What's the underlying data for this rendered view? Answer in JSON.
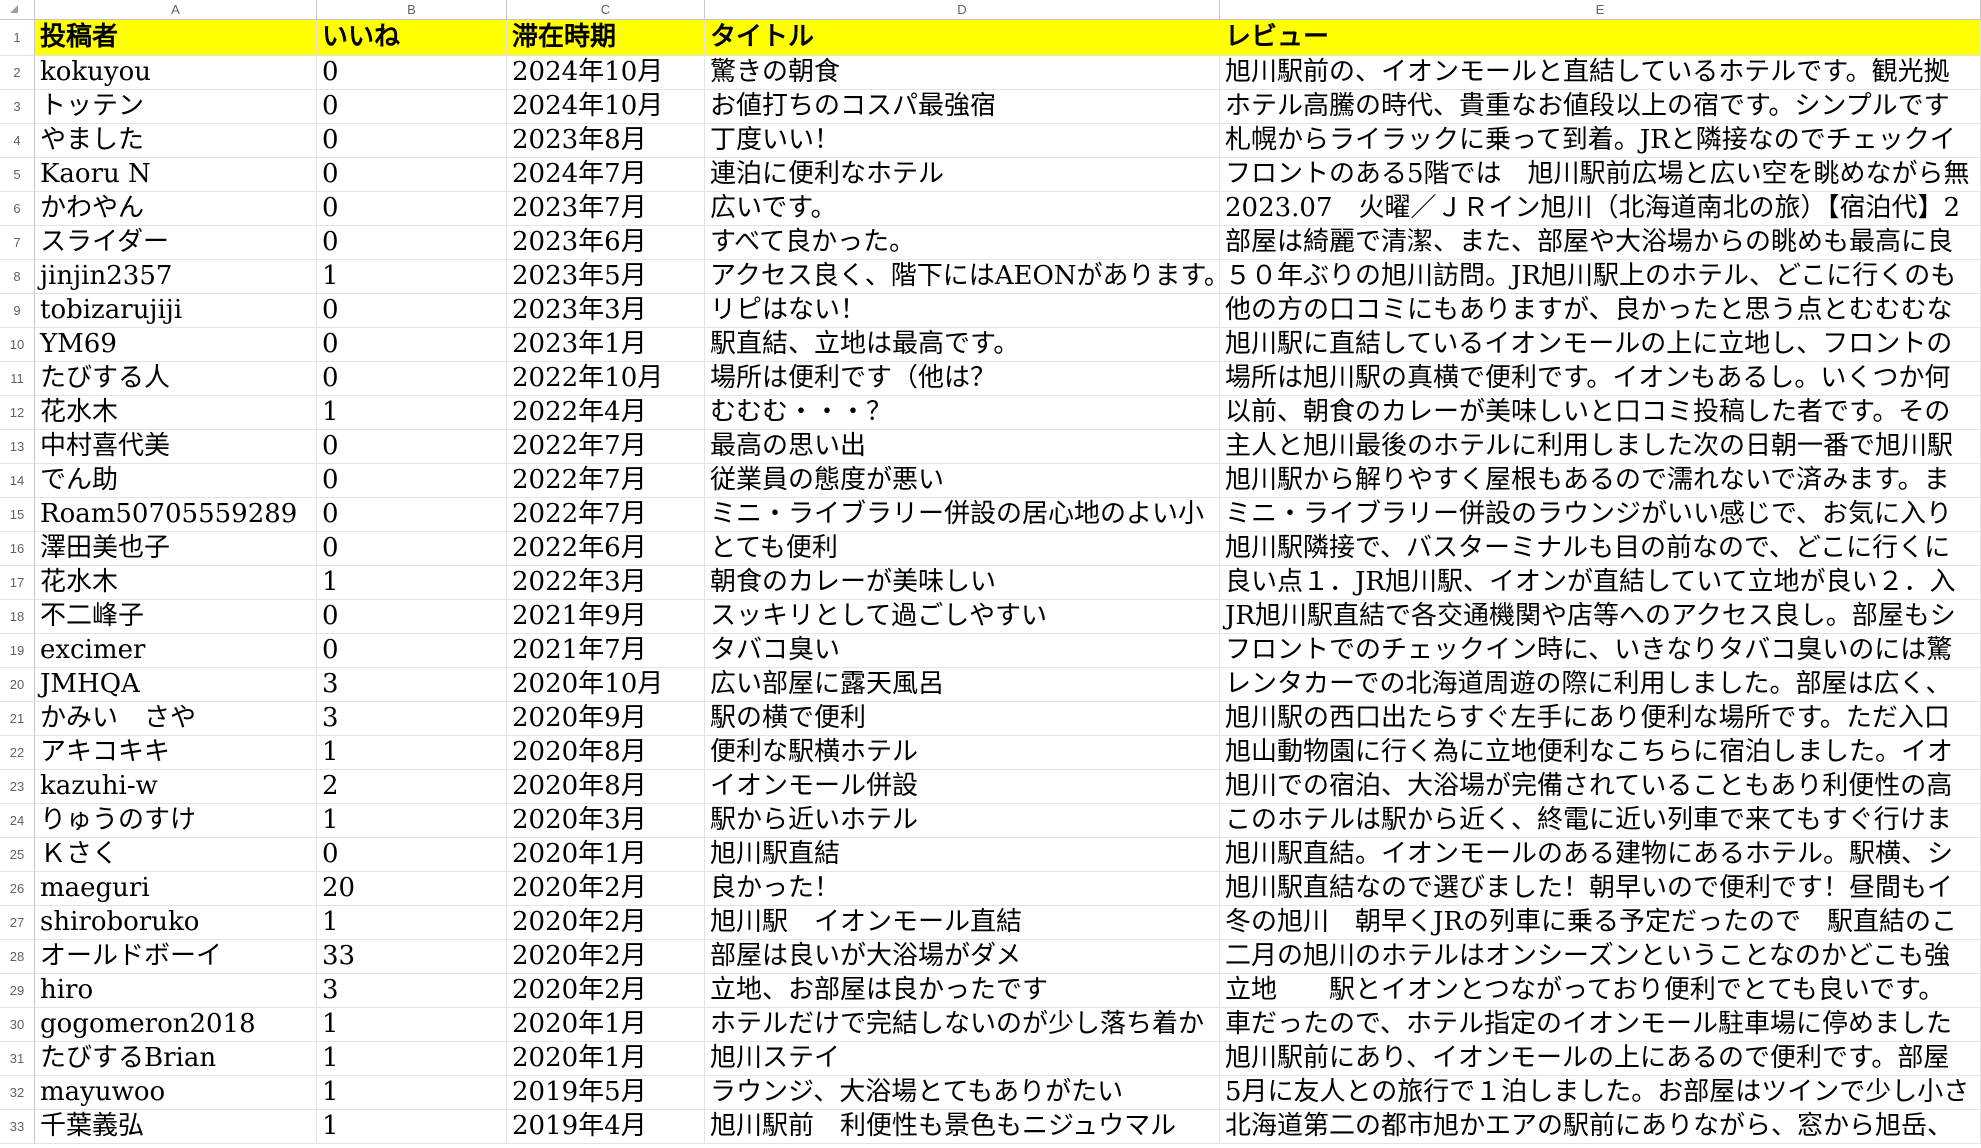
{
  "sheet": {
    "column_letters": [
      "A",
      "B",
      "C",
      "D",
      "E"
    ],
    "header": {
      "row_number": "1",
      "cells": [
        "投稿者",
        "いいね",
        "滞在時期",
        "タイトル",
        "レビュー"
      ]
    },
    "rows": [
      {
        "row_number": "2",
        "cells": [
          "kokuyou",
          "0",
          "2024年10月",
          "驚きの朝食",
          "旭川駅前の、イオンモールと直結しているホテルです。観光拠"
        ]
      },
      {
        "row_number": "3",
        "cells": [
          "トッテン",
          "0",
          "2024年10月",
          "お値打ちのコスパ最強宿",
          "ホテル高騰の時代、貴重なお値段以上の宿です。シンプルです"
        ]
      },
      {
        "row_number": "4",
        "cells": [
          "やました",
          "0",
          "2023年8月",
          "丁度いい！",
          "札幌からライラックに乗って到着。JRと隣接なのでチェックイ"
        ]
      },
      {
        "row_number": "5",
        "cells": [
          "Kaoru N",
          "0",
          "2024年7月",
          "連泊に便利なホテル",
          "フロントのある5階では　旭川駅前広場と広い空を眺めながら無"
        ]
      },
      {
        "row_number": "6",
        "cells": [
          "かわやん",
          "0",
          "2023年7月",
          "広いです。",
          "2023.07　火曜／ＪＲイン旭川（北海道南北の旅）【宿泊代】2"
        ]
      },
      {
        "row_number": "7",
        "cells": [
          "スライダー",
          "0",
          "2023年6月",
          "すべて良かった。",
          "部屋は綺麗で清潔、また、部屋や大浴場からの眺めも最高に良"
        ]
      },
      {
        "row_number": "8",
        "cells": [
          "jinjin2357",
          "1",
          "2023年5月",
          "アクセス良く、階下にはAEONがあります。",
          "５０年ぶりの旭川訪問。JR旭川駅上のホテル、どこに行くのも"
        ]
      },
      {
        "row_number": "9",
        "cells": [
          "tobizarujiji",
          "0",
          "2023年3月",
          "リピはない！",
          "他の方の口コミにもありますが、良かったと思う点とむむむな"
        ]
      },
      {
        "row_number": "10",
        "cells": [
          "YM69",
          "0",
          "2023年1月",
          "駅直結、立地は最高です。",
          "旭川駅に直結しているイオンモールの上に立地し、フロントの"
        ]
      },
      {
        "row_number": "11",
        "cells": [
          "たびする人",
          "0",
          "2022年10月",
          "場所は便利です（他は？",
          "場所は旭川駅の真横で便利です。イオンもあるし。いくつか何"
        ]
      },
      {
        "row_number": "12",
        "cells": [
          "花水木",
          "1",
          "2022年4月",
          "むむむ・・・？",
          "以前、朝食のカレーが美味しいと口コミ投稿した者です。その"
        ]
      },
      {
        "row_number": "13",
        "cells": [
          "中村喜代美",
          "0",
          "2022年7月",
          "最高の思い出",
          "主人と旭川最後のホテルに利用しました次の日朝一番で旭川駅"
        ]
      },
      {
        "row_number": "14",
        "cells": [
          "でん助",
          "0",
          "2022年7月",
          "従業員の態度が悪い",
          "旭川駅から解りやすく屋根もあるので濡れないで済みます。ま"
        ]
      },
      {
        "row_number": "15",
        "cells": [
          "Roam50705559289",
          "0",
          "2022年7月",
          "ミニ・ライブラリー併設の居心地のよい小",
          "ミニ・ライブラリー併設のラウンジがいい感じで、お気に入り"
        ]
      },
      {
        "row_number": "16",
        "cells": [
          "澤田美也子",
          "0",
          "2022年6月",
          "とても便利",
          "旭川駅隣接で、バスターミナルも目の前なので、どこに行くに"
        ]
      },
      {
        "row_number": "17",
        "cells": [
          "花水木",
          "1",
          "2022年3月",
          "朝食のカレーが美味しい",
          "良い点１．JR旭川駅、イオンが直結していて立地が良い２．入"
        ]
      },
      {
        "row_number": "18",
        "cells": [
          "不二峰子",
          "0",
          "2021年9月",
          "スッキリとして過ごしやすい",
          "JR旭川駅直結で各交通機関や店等へのアクセス良し。部屋もシ"
        ]
      },
      {
        "row_number": "19",
        "cells": [
          "excimer",
          "0",
          "2021年7月",
          "タバコ臭い",
          "フロントでのチェックイン時に、いきなりタバコ臭いのには驚"
        ]
      },
      {
        "row_number": "20",
        "cells": [
          "JMHQA",
          "3",
          "2020年10月",
          "広い部屋に露天風呂",
          "レンタカーでの北海道周遊の際に利用しました。部屋は広く、"
        ]
      },
      {
        "row_number": "21",
        "cells": [
          "かみい　さや",
          "3",
          "2020年9月",
          "駅の横で便利",
          "旭川駅の西口出たらすぐ左手にあり便利な場所です。ただ入口"
        ]
      },
      {
        "row_number": "22",
        "cells": [
          "アキコキキ",
          "1",
          "2020年8月",
          "便利な駅横ホテル",
          "旭山動物園に行く為に立地便利なこちらに宿泊しました。イオ"
        ]
      },
      {
        "row_number": "23",
        "cells": [
          "kazuhi-w",
          "2",
          "2020年8月",
          "イオンモール併設",
          "旭川での宿泊、大浴場が完備されていることもあり利便性の高"
        ]
      },
      {
        "row_number": "24",
        "cells": [
          "りゅうのすけ",
          "1",
          "2020年3月",
          "駅から近いホテル",
          "このホテルは駅から近く、終電に近い列車で来てもすぐ行けま"
        ]
      },
      {
        "row_number": "25",
        "cells": [
          "Ｋさく",
          "0",
          "2020年1月",
          "旭川駅直結",
          "旭川駅直結。イオンモールのある建物にあるホテル。駅横、シ"
        ]
      },
      {
        "row_number": "26",
        "cells": [
          "maeguri",
          "20",
          "2020年2月",
          "良かった！",
          "旭川駅直結なので選びました！朝早いので便利です！昼間もイ"
        ]
      },
      {
        "row_number": "27",
        "cells": [
          "shiroboruko",
          "1",
          "2020年2月",
          "旭川駅　イオンモール直結",
          "冬の旭川　朝早くJRの列車に乗る予定だったので　駅直結のこ"
        ]
      },
      {
        "row_number": "28",
        "cells": [
          "オールドボーイ",
          "33",
          "2020年2月",
          "部屋は良いが大浴場がダメ",
          "二月の旭川のホテルはオンシーズンということなのかどこも強"
        ]
      },
      {
        "row_number": "29",
        "cells": [
          "hiro",
          "3",
          "2020年2月",
          "立地、お部屋は良かったです",
          "立地　　駅とイオンとつながっており便利でとても良いです。"
        ]
      },
      {
        "row_number": "30",
        "cells": [
          "gogomeron2018",
          "1",
          "2020年1月",
          "ホテルだけで完結しないのが少し落ち着か",
          "車だったので、ホテル指定のイオンモール駐車場に停めました"
        ]
      },
      {
        "row_number": "31",
        "cells": [
          "たびするBrian",
          "1",
          "2020年1月",
          "旭川ステイ",
          "旭川駅前にあり、イオンモールの上にあるので便利です。部屋"
        ]
      },
      {
        "row_number": "32",
        "cells": [
          "mayuwoo",
          "1",
          "2019年5月",
          "ラウンジ、大浴場とてもありがたい",
          "5月に友人との旅行で１泊しました。お部屋はツインで少し小さ"
        ]
      },
      {
        "row_number": "33",
        "cells": [
          "千葉義弘",
          "1",
          "2019年4月",
          "旭川駅前　利便性も景色もニジュウマル",
          "北海道第二の都市旭かエアの駅前にありながら、窓から旭岳、"
        ]
      }
    ]
  },
  "colors": {
    "header_fill": "#FFFF00",
    "gridline": "#E2E3E3"
  }
}
